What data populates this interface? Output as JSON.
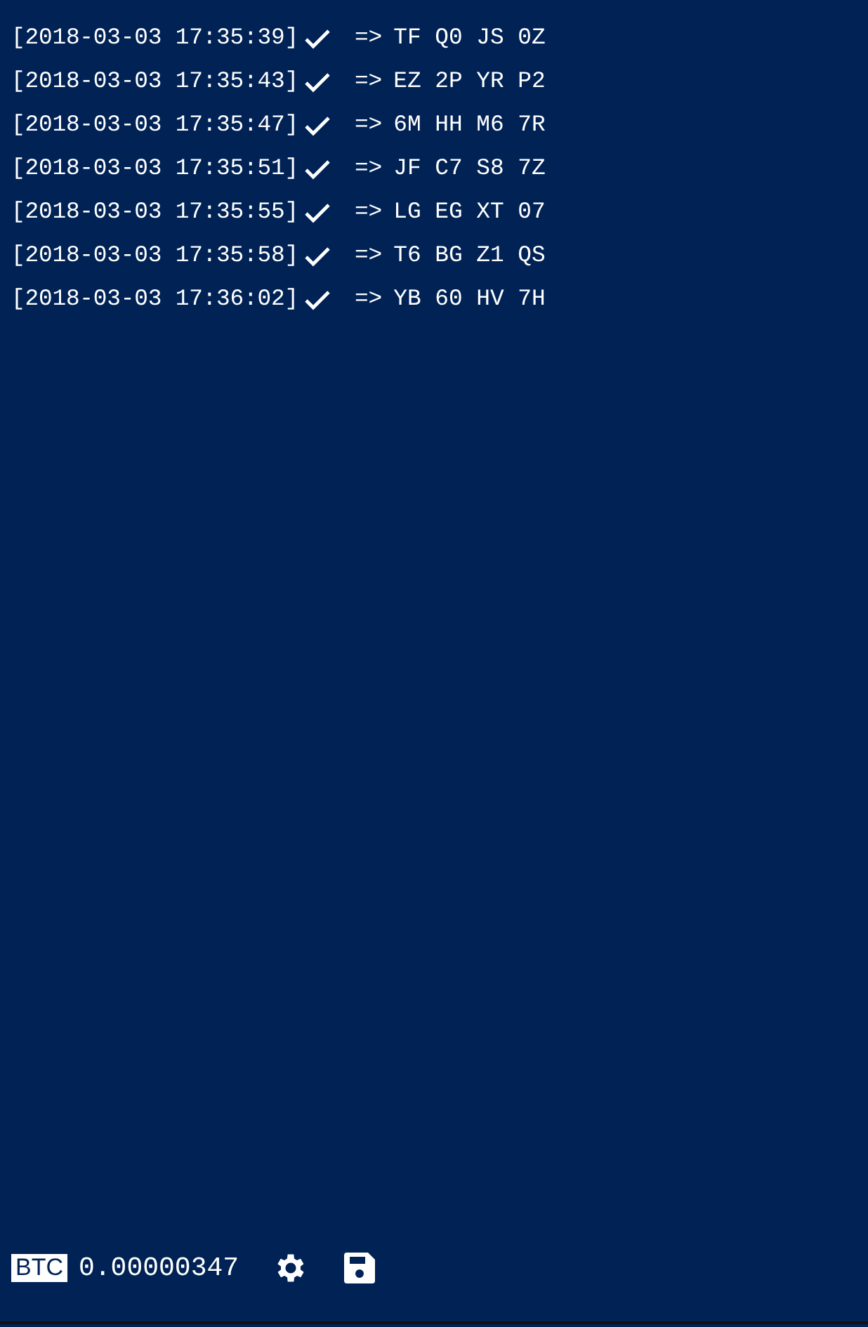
{
  "log": [
    {
      "timestamp": "[2018-03-03 17:35:39]",
      "arrow": "=>",
      "code": "TF Q0 JS 0Z"
    },
    {
      "timestamp": "[2018-03-03 17:35:43]",
      "arrow": "=>",
      "code": "EZ 2P YR P2"
    },
    {
      "timestamp": "[2018-03-03 17:35:47]",
      "arrow": "=>",
      "code": "6M HH M6 7R"
    },
    {
      "timestamp": "[2018-03-03 17:35:51]",
      "arrow": "=>",
      "code": "JF C7 S8 7Z"
    },
    {
      "timestamp": "[2018-03-03 17:35:55]",
      "arrow": "=>",
      "code": "LG EG XT 07"
    },
    {
      "timestamp": "[2018-03-03 17:35:58]",
      "arrow": "=>",
      "code": "T6 BG Z1 QS"
    },
    {
      "timestamp": "[2018-03-03 17:36:02]",
      "arrow": "=>",
      "code": "YB 60 HV 7H"
    }
  ],
  "footer": {
    "currency": "BTC",
    "balance": "0.00000347"
  }
}
